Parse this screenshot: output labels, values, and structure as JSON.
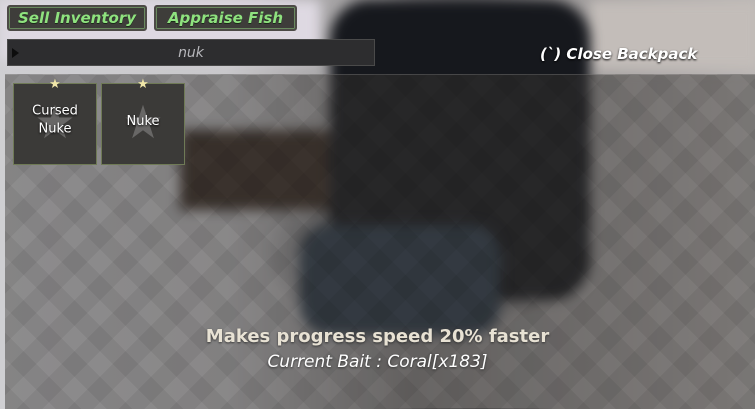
{
  "toolbar": {
    "sell_label": "Sell Inventory",
    "appraise_label": "Appraise Fish"
  },
  "search": {
    "value": "nuk"
  },
  "backpack": {
    "close_label": "(`) Close Backpack"
  },
  "inventory": {
    "items": [
      {
        "label": "Cursed\nNuke",
        "icon": "star-icon",
        "favorited": true
      },
      {
        "label": "Nuke",
        "icon": "star-icon",
        "favorited": true
      }
    ]
  },
  "bait": {
    "description": "Makes progress speed 20% faster",
    "current": "Current Bait : Coral[x183]"
  },
  "colors": {
    "accent_green": "#8fe27f",
    "slot_border": "#6f7a56",
    "favorite_star": "#f0e6a8"
  }
}
